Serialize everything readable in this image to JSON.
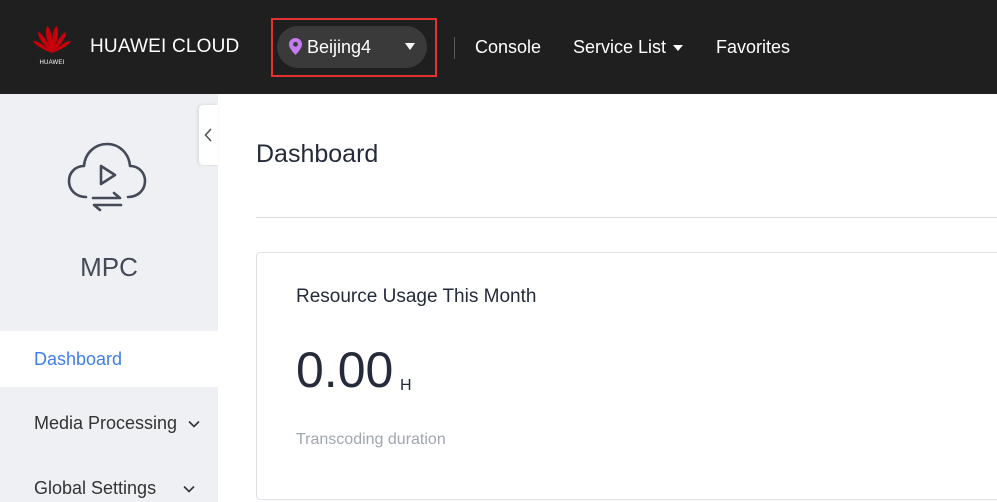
{
  "header": {
    "logo_text": "HUAWEI",
    "brand": "HUAWEI CLOUD",
    "region": "Beijing4",
    "nav": {
      "console": "Console",
      "service_list": "Service List",
      "favorites": "Favorites"
    }
  },
  "sidebar": {
    "service_name": "MPC",
    "items": [
      {
        "label": "Dashboard",
        "active": true
      },
      {
        "label": "Media Processing",
        "expandable": true
      },
      {
        "label": "Global Settings",
        "expandable": true
      }
    ]
  },
  "main": {
    "title": "Dashboard",
    "card": {
      "title": "Resource Usage This Month",
      "value": "0.00",
      "unit": "H",
      "label": "Transcoding duration"
    }
  },
  "colors": {
    "topbar_bg": "#1f1f1f",
    "sidebar_bg": "#eef0f3",
    "accent": "#3f7ee8",
    "highlight": "#e23232",
    "logo_red": "#c7000b",
    "pin": "#c57cf0"
  },
  "icons": {
    "logo": "huawei-flower-logo",
    "region": "location-pin-icon",
    "service": "cloud-media-icon",
    "collapse": "chevron-left-icon",
    "expand": "chevron-down-icon"
  }
}
